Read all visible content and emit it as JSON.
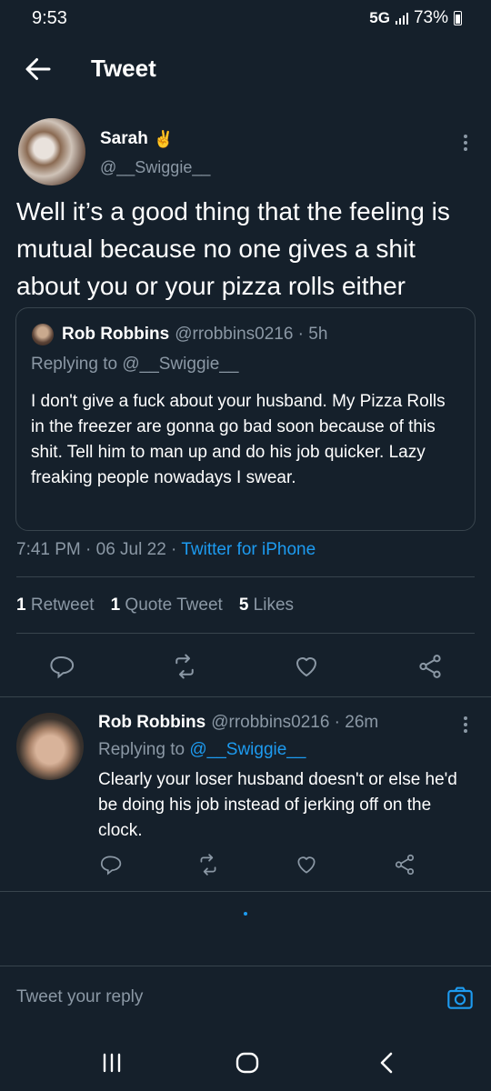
{
  "status_bar": {
    "time": "9:53",
    "network": "5G",
    "battery": "73%"
  },
  "header": {
    "title": "Tweet"
  },
  "tweet": {
    "author_name": "Sarah",
    "author_emoji": "✌️",
    "author_handle": "@__Swiggie__",
    "text": "Well it’s a good thing that the feeling is mutual because no one gives a shit about you or your pizza rolls either",
    "quoted": {
      "author_name": "Rob Robbins",
      "author_handle": "@rrobbins0216 · 5h",
      "replying_to": "Replying to @__Swiggie__",
      "text": "I don't give a fuck about your husband. My Pizza Rolls in the freezer are gonna go bad soon because of this shit. Tell him to man up and do his job quicker. Lazy freaking people nowadays I swear."
    },
    "timestamp": "7:41 PM · 06 Jul 22 · ",
    "source": "Twitter for iPhone",
    "stats": {
      "retweets_count": "1",
      "retweets_label": "Retweet",
      "quotes_count": "1",
      "quotes_label": "Quote Tweet",
      "likes_count": "5",
      "likes_label": "Likes"
    }
  },
  "reply": {
    "author_name": "Rob Robbins",
    "author_meta": "@rrobbins0216 · 26m",
    "replying_prefix": "Replying to ",
    "replying_handle": "@__Swiggie__",
    "text": "Clearly your loser husband doesn't or else he'd be doing his job instead of jerking off on the clock."
  },
  "composer": {
    "placeholder": "Tweet your reply"
  },
  "icons": {
    "back": "arrow-left-icon",
    "more": "more-vertical-icon",
    "reply": "comment-icon",
    "retweet": "retweet-icon",
    "like": "heart-icon",
    "share": "share-icon",
    "camera": "camera-icon",
    "nav_recents": "recents-icon",
    "nav_home": "home-icon",
    "nav_back": "back-chevron-icon"
  },
  "colors": {
    "background": "#15202b",
    "accent": "#1d9bf0",
    "muted": "#8b98a5",
    "border": "#38444d"
  }
}
